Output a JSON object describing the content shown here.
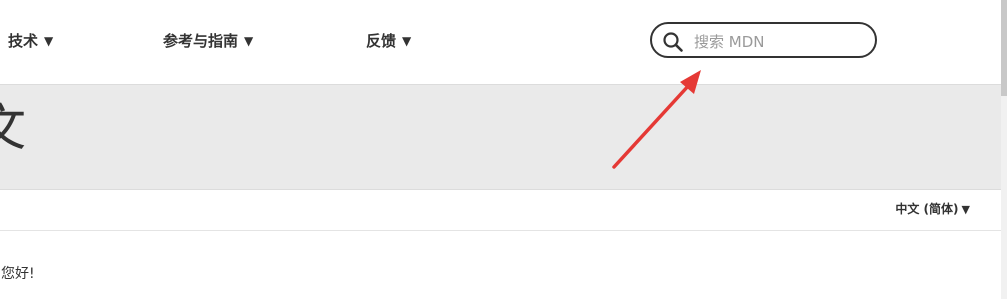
{
  "nav": {
    "items": [
      {
        "label": "技术",
        "caret": "▼"
      },
      {
        "label": "参考与指南",
        "caret": "▼"
      },
      {
        "label": "反馈",
        "caret": "▼"
      }
    ]
  },
  "search": {
    "placeholder": "搜索 MDN",
    "icon": "search-icon"
  },
  "hero": {
    "title_fragment": "文"
  },
  "language": {
    "label": "中文 (简体)",
    "caret": "▼"
  },
  "content": {
    "greeting": "您好!"
  },
  "colors": {
    "nav_text": "#333333",
    "hero_bg": "#eaeaea",
    "search_border": "#333333",
    "annotation_arrow": "#e53935"
  }
}
